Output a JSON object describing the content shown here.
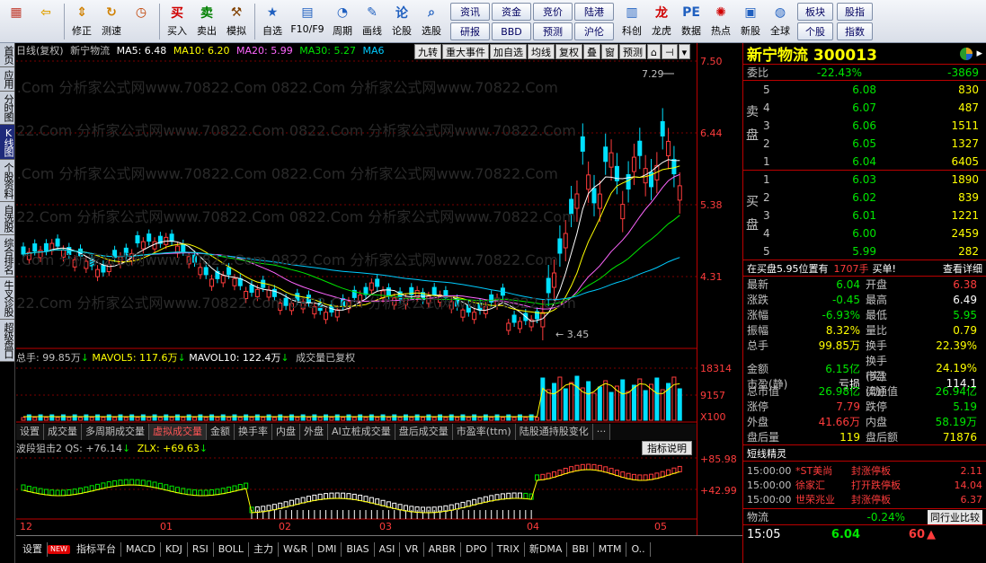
{
  "toolbar": {
    "items": [
      {
        "label": "",
        "icon": "windows-grid-icon"
      },
      {
        "label": "",
        "icon": "back-arrow-icon"
      },
      {
        "label": "修正",
        "icon": "updown-arrows-icon"
      },
      {
        "label": "测速",
        "icon": "refresh-icon"
      },
      {
        "label": "",
        "icon": "clock-icon"
      },
      {
        "label": "买入",
        "icon": "buy-icon"
      },
      {
        "label": "卖出",
        "icon": "sell-icon"
      },
      {
        "label": "模拟",
        "icon": "hammer-icon"
      },
      {
        "label": "自选",
        "icon": "star-list-icon"
      },
      {
        "label": "F10/F9",
        "icon": "doc-icon"
      },
      {
        "label": "周期",
        "icon": "period-icon"
      },
      {
        "label": "画线",
        "icon": "pencil-icon"
      },
      {
        "label": "论股",
        "icon": "chat-icon"
      },
      {
        "label": "选股",
        "icon": "magnifier-chart-icon"
      }
    ],
    "text_buttons": [
      "资讯",
      "资金",
      "竞价",
      "陆港",
      "研报",
      "BBD",
      "预测",
      "沪伦"
    ],
    "items2": [
      {
        "label": "科创",
        "icon": "chart-icon"
      },
      {
        "label": "龙虎",
        "icon": "dragon-icon"
      },
      {
        "label": "数据",
        "icon": "pe-icon"
      },
      {
        "label": "热点",
        "icon": "hot-icon"
      },
      {
        "label": "新股",
        "icon": "ipo-icon"
      },
      {
        "label": "全球",
        "icon": "globe-icon"
      }
    ],
    "text_buttons2": [
      "板块",
      "个股"
    ],
    "text_buttons3": [
      "股指",
      "指数"
    ]
  },
  "left_tabs": [
    "首页",
    "应用",
    "分时图",
    "K线图",
    "个股资料",
    "自选股",
    "综合排名",
    "牛叉诊股",
    "超级盘口"
  ],
  "chart": {
    "title_prefix": "日线(复权)",
    "stock_name": "新宁物流",
    "ma5": "MA5: 6.48",
    "ma10": "MA10: 6.20",
    "ma20": "MA20: 5.99",
    "ma30": "MA30: 5.27",
    "ma6": "MA6",
    "top_tabs": [
      "九转",
      "重大事件",
      "加自选",
      "均线",
      "复权",
      "叠",
      "窗",
      "预测"
    ],
    "high_label": "7.29",
    "low_label": "3.45",
    "watermark": "0822.Com 分析家公式网www.70822.Com",
    "vol_total": "总手: 99.85万",
    "mavol5": "MAVOL5: 117.6万",
    "mavol10": "MAVOL10: 122.4万",
    "vol_note": "成交量已复权",
    "sub_tabs": [
      "设置",
      "成交量",
      "多周期成交量",
      "虚拟成交量",
      "金额",
      "换手率",
      "内盘",
      "外盘",
      "AI立桩成交量",
      "盘后成交量",
      "市盈率(ttm)",
      "陆股通持股变化",
      "···"
    ],
    "ind_name": "波段狙击2 QS: +76.14",
    "zlx": "ZLX: +69.63",
    "ind_button": "指标说明",
    "dates": [
      "12",
      "01",
      "02",
      "03",
      "04",
      "05"
    ]
  },
  "chart_data": {
    "type": "candlestick",
    "price_scale": [
      "7.50",
      "6.44",
      "5.38",
      "4.31"
    ],
    "volume_scale": [
      "18314",
      "9157",
      "X100"
    ],
    "indicator_scale": [
      "+85.98",
      "+42.99"
    ],
    "high": 7.29,
    "low": 3.45
  },
  "bottom_tabs": [
    "设置",
    "NEW",
    "指标平台",
    "MACD",
    "KDJ",
    "RSI",
    "BOLL",
    "主力",
    "W&R",
    "DMI",
    "BIAS",
    "ASI",
    "VR",
    "ARBR",
    "DPO",
    "TRIX",
    "新DMA",
    "BBI",
    "MTM",
    "O.."
  ],
  "quote": {
    "name": "新宁物流",
    "code": "300013",
    "weibi_label": "委比",
    "weibi": "-22.43%",
    "weicha": "-3869",
    "sell_side": "卖盘",
    "buy_side": "买盘",
    "asks": [
      {
        "lvl": "5",
        "price": "6.08",
        "qty": "830"
      },
      {
        "lvl": "4",
        "price": "6.07",
        "qty": "487"
      },
      {
        "lvl": "3",
        "price": "6.06",
        "qty": "1511"
      },
      {
        "lvl": "2",
        "price": "6.05",
        "qty": "1327"
      },
      {
        "lvl": "1",
        "price": "6.04",
        "qty": "6405"
      }
    ],
    "bids": [
      {
        "lvl": "1",
        "price": "6.03",
        "qty": "1890"
      },
      {
        "lvl": "2",
        "price": "6.02",
        "qty": "839"
      },
      {
        "lvl": "3",
        "price": "6.01",
        "qty": "1221"
      },
      {
        "lvl": "4",
        "price": "6.00",
        "qty": "2459"
      },
      {
        "lvl": "5",
        "price": "5.99",
        "qty": "282"
      }
    ],
    "zaimai_text": "在买盘5.95位置有",
    "zaimai_qty": "1707手",
    "zaimai_tail": "买单!",
    "detail_btn": "查看详细",
    "stats": [
      [
        "最新",
        "6.04",
        "开盘",
        "6.38"
      ],
      [
        "涨跌",
        "-0.45",
        "最高",
        "6.49"
      ],
      [
        "涨幅",
        "-6.93%",
        "最低",
        "5.95"
      ],
      [
        "振幅",
        "8.32%",
        "量比",
        "0.79"
      ],
      [
        "总手",
        "99.85万",
        "换手",
        "22.39%"
      ],
      [
        "金额",
        "6.15亿",
        "换手(实)",
        "24.19%"
      ],
      [
        "市盈(静)",
        "亏损",
        "市盈(动)",
        "114.1"
      ],
      [
        "总市值",
        "26.98亿",
        "流通值",
        "26.94亿"
      ],
      [
        "涨停",
        "7.79",
        "跌停",
        "5.19"
      ],
      [
        "外盘",
        "41.66万",
        "内盘",
        "58.19万"
      ],
      [
        "盘后量",
        "119",
        "盘后额",
        "71876"
      ]
    ],
    "shortline_title": "短线精灵",
    "news": [
      {
        "time": "15:00:00",
        "name": "*ST美尚",
        "event": "封涨停板",
        "val": "2.11"
      },
      {
        "time": "15:00:00",
        "name": "徐家汇",
        "event": "打开跌停板",
        "val": "14.04"
      },
      {
        "time": "15:00:00",
        "name": "世荣兆业",
        "event": "封涨停板",
        "val": "6.37"
      }
    ],
    "industry_name": "物流",
    "industry_pct": "-0.24%",
    "industry_btn": "同行业比较",
    "time": "15:05",
    "last_price": "6.04",
    "last_vol": "60"
  }
}
